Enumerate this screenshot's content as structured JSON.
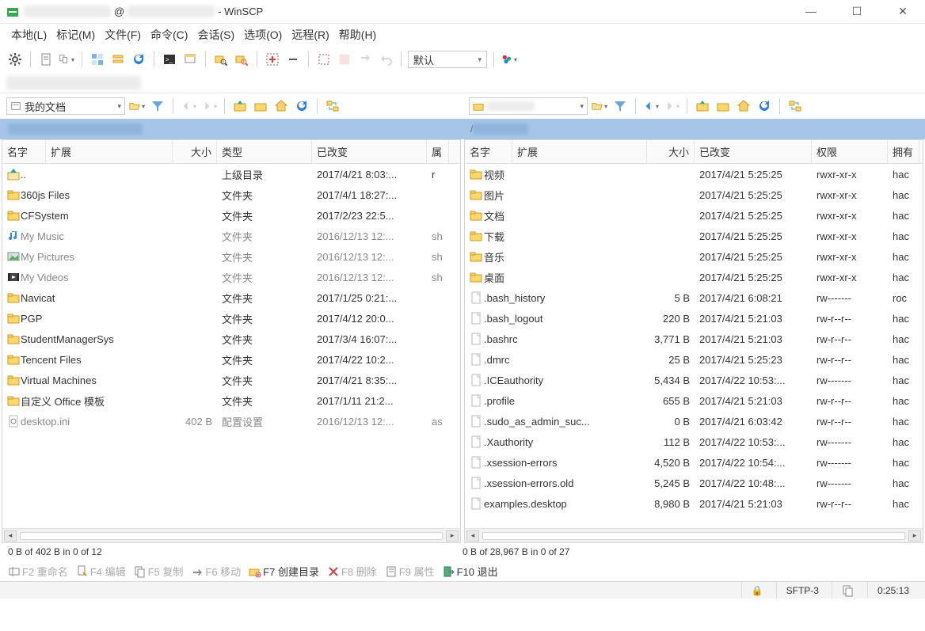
{
  "title": {
    "prefix_obscured": "xxxxxxxx",
    "at": "@",
    "host_obscured": "xxxxxxxxxx",
    "suffix": " - WinSCP"
  },
  "window_controls": {
    "min": "—",
    "max": "☐",
    "close": "✕"
  },
  "menus": [
    "本地(L)",
    "标记(M)",
    "文件(F)",
    "命令(C)",
    "会话(S)",
    "选项(O)",
    "远程(R)",
    "帮助(H)"
  ],
  "toolbar1": {
    "gear": "⚙",
    "items": [
      "📄",
      "📑▾",
      "",
      "📁",
      "📅",
      "🔄",
      "",
      "🖥",
      "🔧",
      "",
      "📂",
      "🔍"
    ],
    "icons": [
      "gear",
      "doc",
      "docsplit",
      "sep",
      "tile",
      "calendar",
      "refresh",
      "sep",
      "term",
      "wrench",
      "sep",
      "find-local",
      "find-remote",
      "sep",
      "plus-grid",
      "minus",
      "sep",
      "sel-none",
      "sel-all",
      "swap",
      "undo",
      "sep"
    ],
    "default_combo": "默认",
    "right_icons": [
      "session-tabs"
    ]
  },
  "locbar_left": {
    "label": "我的文档",
    "icons": [
      "open",
      "filter",
      "sep",
      "back",
      "fwd",
      "sep",
      "up",
      "new",
      "home",
      "refresh",
      "sep",
      "sync"
    ]
  },
  "locbar_right": {
    "label_obscured": "xxxxxx",
    "icons": [
      "open",
      "filter",
      "sep",
      "back",
      "fwd",
      "sep",
      "up",
      "new",
      "home",
      "refresh",
      "sep",
      "sync"
    ]
  },
  "path_left_obscured": "C:\\Users\\Squid\\Documents",
  "path_right_obscured": "/xxxxxxxx",
  "columns_left": [
    "名字",
    "扩展",
    "大小",
    "类型",
    "已改变",
    "属"
  ],
  "columns_right": [
    "名字",
    "扩展",
    "大小",
    "已改变",
    "权限",
    "拥有"
  ],
  "rows_left": [
    {
      "icon": "up",
      "name": "..",
      "type": "上级目录",
      "chg": "2017/4/21  8:03:...",
      "attr": "r"
    },
    {
      "icon": "folder",
      "name": "360js Files",
      "type": "文件夹",
      "chg": "2017/4/1  18:27:...",
      "attr": ""
    },
    {
      "icon": "folder",
      "name": "CFSystem",
      "type": "文件夹",
      "chg": "2017/2/23  22:5...",
      "attr": ""
    },
    {
      "icon": "music",
      "dim": true,
      "name": "My Music",
      "type": "文件夹",
      "chg": "2016/12/13  12:...",
      "attr": "sh"
    },
    {
      "icon": "pic",
      "dim": true,
      "name": "My Pictures",
      "type": "文件夹",
      "chg": "2016/12/13  12:...",
      "attr": "sh"
    },
    {
      "icon": "video",
      "dim": true,
      "name": "My Videos",
      "type": "文件夹",
      "chg": "2016/12/13  12:...",
      "attr": "sh"
    },
    {
      "icon": "folder",
      "name": "Navicat",
      "type": "文件夹",
      "chg": "2017/1/25  0:21:...",
      "attr": ""
    },
    {
      "icon": "folder",
      "name": "PGP",
      "type": "文件夹",
      "chg": "2017/4/12  20:0...",
      "attr": ""
    },
    {
      "icon": "folder",
      "name": "StudentManagerSys",
      "type": "文件夹",
      "chg": "2017/3/4  16:07:...",
      "attr": ""
    },
    {
      "icon": "folder",
      "name": "Tencent Files",
      "type": "文件夹",
      "chg": "2017/4/22  10:2...",
      "attr": ""
    },
    {
      "icon": "folder",
      "name": "Virtual Machines",
      "type": "文件夹",
      "chg": "2017/4/21  8:35:...",
      "attr": ""
    },
    {
      "icon": "folder",
      "name": "自定义 Office 模板",
      "type": "文件夹",
      "chg": "2017/1/11  21:2...",
      "attr": ""
    },
    {
      "icon": "ini",
      "dim": true,
      "name": "desktop.ini",
      "size": "402 B",
      "type": "配置设置",
      "chg": "2016/12/13  12:...",
      "attr": "as"
    }
  ],
  "rows_right": [
    {
      "icon": "folder",
      "name": "视频",
      "chg": "2017/4/21 5:25:25",
      "perm": "rwxr-xr-x",
      "own": "hac"
    },
    {
      "icon": "folder",
      "name": "图片",
      "chg": "2017/4/21 5:25:25",
      "perm": "rwxr-xr-x",
      "own": "hac"
    },
    {
      "icon": "folder",
      "name": "文档",
      "chg": "2017/4/21 5:25:25",
      "perm": "rwxr-xr-x",
      "own": "hac"
    },
    {
      "icon": "folder",
      "name": "下载",
      "chg": "2017/4/21 5:25:25",
      "perm": "rwxr-xr-x",
      "own": "hac"
    },
    {
      "icon": "folder",
      "name": "音乐",
      "chg": "2017/4/21 5:25:25",
      "perm": "rwxr-xr-x",
      "own": "hac"
    },
    {
      "icon": "folder",
      "name": "桌面",
      "chg": "2017/4/21 5:25:25",
      "perm": "rwxr-xr-x",
      "own": "hac"
    },
    {
      "icon": "file",
      "name": ".bash_history",
      "size": "5 B",
      "chg": "2017/4/21 6:08:21",
      "perm": "rw-------",
      "own": "roc"
    },
    {
      "icon": "file",
      "name": ".bash_logout",
      "size": "220 B",
      "chg": "2017/4/21 5:21:03",
      "perm": "rw-r--r--",
      "own": "hac"
    },
    {
      "icon": "file",
      "name": ".bashrc",
      "size": "3,771 B",
      "chg": "2017/4/21 5:21:03",
      "perm": "rw-r--r--",
      "own": "hac"
    },
    {
      "icon": "file",
      "name": ".dmrc",
      "size": "25 B",
      "chg": "2017/4/21 5:25:23",
      "perm": "rw-r--r--",
      "own": "hac"
    },
    {
      "icon": "file",
      "name": ".ICEauthority",
      "size": "5,434 B",
      "chg": "2017/4/22 10:53:...",
      "perm": "rw-------",
      "own": "hac"
    },
    {
      "icon": "file",
      "name": ".profile",
      "size": "655 B",
      "chg": "2017/4/21 5:21:03",
      "perm": "rw-r--r--",
      "own": "hac"
    },
    {
      "icon": "file",
      "name": ".sudo_as_admin_suc...",
      "size": "0 B",
      "chg": "2017/4/21 6:03:42",
      "perm": "rw-r--r--",
      "own": "hac"
    },
    {
      "icon": "file",
      "name": ".Xauthority",
      "size": "112 B",
      "chg": "2017/4/22 10:53:...",
      "perm": "rw-------",
      "own": "hac"
    },
    {
      "icon": "file",
      "name": ".xsession-errors",
      "size": "4,520 B",
      "chg": "2017/4/22 10:54:...",
      "perm": "rw-------",
      "own": "hac"
    },
    {
      "icon": "file",
      "name": ".xsession-errors.old",
      "size": "5,245 B",
      "chg": "2017/4/22 10:48:...",
      "perm": "rw-------",
      "own": "hac"
    },
    {
      "icon": "file",
      "name": "examples.desktop",
      "size": "8,980 B",
      "chg": "2017/4/21 5:21:03",
      "perm": "rw-r--r--",
      "own": "hac"
    }
  ],
  "sel_left": "0 B of 402 B in 0 of 12",
  "sel_right": "0 B of 28,967 B in 0 of 27",
  "fnkeys": [
    {
      "key": "F2",
      "label": "重命名",
      "dim": true,
      "icon": "rename"
    },
    {
      "key": "F4",
      "label": "编辑",
      "dim": true,
      "icon": "edit"
    },
    {
      "key": "F5",
      "label": "复制",
      "dim": true,
      "icon": "copy"
    },
    {
      "key": "F6",
      "label": "移动",
      "dim": true,
      "icon": "move"
    },
    {
      "key": "F7",
      "label": "创建目录",
      "dim": false,
      "icon": "mkdir"
    },
    {
      "key": "F8",
      "label": "删除",
      "dim": true,
      "icon": "delete"
    },
    {
      "key": "F9",
      "label": "属性",
      "dim": true,
      "icon": "props"
    },
    {
      "key": "F10",
      "label": "退出",
      "dim": false,
      "icon": "exit"
    }
  ],
  "status": {
    "lock": "🔒",
    "proto": "SFTP-3",
    "time": "0:25:13"
  }
}
